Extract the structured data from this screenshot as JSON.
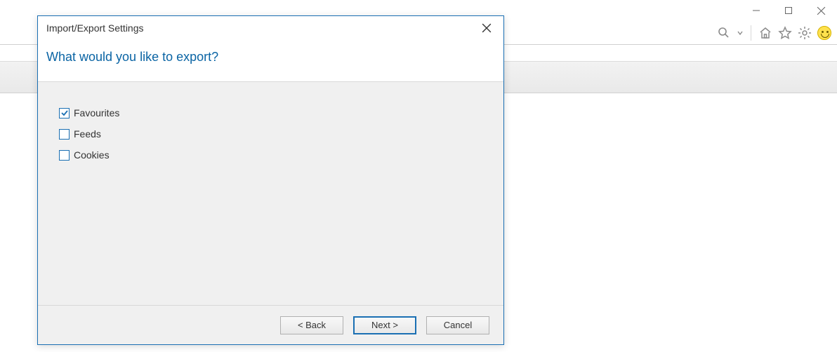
{
  "dialog": {
    "title": "Import/Export Settings",
    "heading": "What would you like to export?",
    "options": [
      {
        "label": "Favourites",
        "checked": true
      },
      {
        "label": "Feeds",
        "checked": false
      },
      {
        "label": "Cookies",
        "checked": false
      }
    ],
    "buttons": {
      "back": "< Back",
      "next": "Next >",
      "cancel": "Cancel"
    }
  }
}
